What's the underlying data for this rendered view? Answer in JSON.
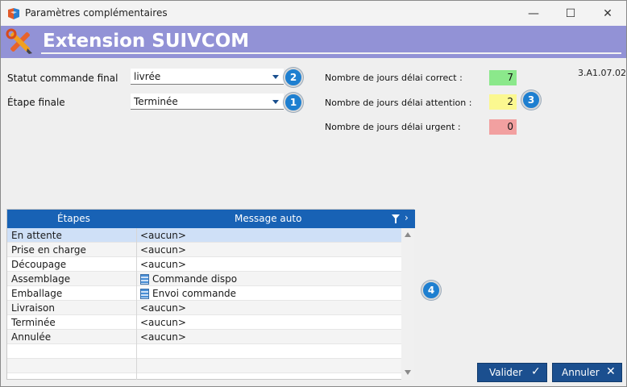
{
  "window": {
    "title": "Paramètres complémentaires",
    "minimize": "—",
    "maximize": "☐",
    "close": "✕"
  },
  "header": {
    "title": "Extension SUIVCOM",
    "icon": "tools-icon"
  },
  "version": "3.A1.07.02",
  "fields": {
    "statut_label": "Statut commande final",
    "statut_value": "livrée",
    "etape_label": "Étape finale",
    "etape_value": "Terminée"
  },
  "delays": {
    "correct_label": "Nombre de jours délai correct :",
    "correct_value": "7",
    "correct_color": "#8be88b",
    "attention_label": "Nombre de jours délai attention :",
    "attention_value": "2",
    "attention_color": "#fbf890",
    "urgent_label": "Nombre de jours délai urgent :",
    "urgent_value": "0",
    "urgent_color": "#f2a0a0"
  },
  "badges": [
    "2",
    "1",
    "3",
    "4"
  ],
  "grid": {
    "headers": [
      "Étapes",
      "Message auto"
    ],
    "rows": [
      {
        "etape": "En attente",
        "message": "<aucun>",
        "icon": false
      },
      {
        "etape": "Prise en charge",
        "message": "<aucun>",
        "icon": false
      },
      {
        "etape": "Découpage",
        "message": "<aucun>",
        "icon": false
      },
      {
        "etape": "Assemblage",
        "message": "Commande dispo",
        "icon": true
      },
      {
        "etape": "Emballage",
        "message": "Envoi commande",
        "icon": true
      },
      {
        "etape": "Livraison",
        "message": "<aucun>",
        "icon": false
      },
      {
        "etape": "Terminée",
        "message": "<aucun>",
        "icon": false
      },
      {
        "etape": "Annulée",
        "message": "<aucun>",
        "icon": false
      }
    ]
  },
  "buttons": {
    "validate": "Valider",
    "validate_icon": "✓",
    "cancel": "Annuler",
    "cancel_icon": "✕"
  },
  "colors": {
    "header_bg": "#9292d6",
    "grid_header": "#1862b5",
    "button": "#1b4f8f",
    "badge": "#1e7fd0"
  }
}
